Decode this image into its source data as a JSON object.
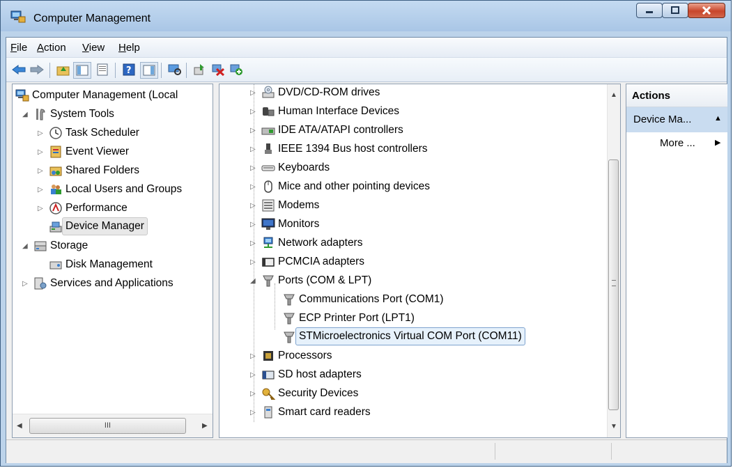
{
  "window": {
    "title": "Computer Management"
  },
  "menu": [
    {
      "key": "F",
      "rest": "ile"
    },
    {
      "key": "A",
      "rest": "ction"
    },
    {
      "key": "V",
      "rest": "iew"
    },
    {
      "key": "H",
      "rest": "elp"
    }
  ],
  "left_tree": [
    {
      "label": "Computer Management (Local",
      "icon": "computer-management-icon",
      "level": 0,
      "expander": "none"
    },
    {
      "label": "System Tools",
      "icon": "tools-icon",
      "level": 1,
      "expander": "expanded"
    },
    {
      "label": "Task Scheduler",
      "icon": "clock-icon",
      "level": 2,
      "expander": "collapsed"
    },
    {
      "label": "Event Viewer",
      "icon": "event-viewer-icon",
      "level": 2,
      "expander": "collapsed"
    },
    {
      "label": "Shared Folders",
      "icon": "shared-folder-icon",
      "level": 2,
      "expander": "collapsed"
    },
    {
      "label": "Local Users and Groups",
      "icon": "users-icon",
      "level": 2,
      "expander": "collapsed"
    },
    {
      "label": "Performance",
      "icon": "performance-icon",
      "level": 2,
      "expander": "collapsed"
    },
    {
      "label": "Device Manager",
      "icon": "device-manager-icon",
      "level": 2,
      "expander": "none",
      "state": "hover"
    },
    {
      "label": "Storage",
      "icon": "storage-icon",
      "level": 1,
      "expander": "expanded"
    },
    {
      "label": "Disk Management",
      "icon": "disk-icon",
      "level": 2,
      "expander": "none"
    },
    {
      "label": "Services and Applications",
      "icon": "services-icon",
      "level": 1,
      "expander": "collapsed"
    }
  ],
  "hscroll": {
    "thumb_label": "III"
  },
  "device_tree": [
    {
      "label": "DVD/CD-ROM drives",
      "icon": "dvd-drive-icon",
      "level": 0,
      "expander": "collapsed"
    },
    {
      "label": "Human Interface Devices",
      "icon": "hid-icon",
      "level": 0,
      "expander": "collapsed"
    },
    {
      "label": "IDE ATA/ATAPI controllers",
      "icon": "ide-controller-icon",
      "level": 0,
      "expander": "collapsed"
    },
    {
      "label": "IEEE 1394 Bus host controllers",
      "icon": "firewire-icon",
      "level": 0,
      "expander": "collapsed"
    },
    {
      "label": "Keyboards",
      "icon": "keyboard-icon",
      "level": 0,
      "expander": "collapsed"
    },
    {
      "label": "Mice and other pointing devices",
      "icon": "mouse-icon",
      "level": 0,
      "expander": "collapsed"
    },
    {
      "label": "Modems",
      "icon": "modem-icon",
      "level": 0,
      "expander": "collapsed"
    },
    {
      "label": "Monitors",
      "icon": "monitor-icon",
      "level": 0,
      "expander": "collapsed"
    },
    {
      "label": "Network adapters",
      "icon": "network-adapter-icon",
      "level": 0,
      "expander": "collapsed"
    },
    {
      "label": "PCMCIA adapters",
      "icon": "pcmcia-icon",
      "level": 0,
      "expander": "collapsed"
    },
    {
      "label": "Ports (COM & LPT)",
      "icon": "port-icon",
      "level": 0,
      "expander": "expanded"
    },
    {
      "label": "Communications Port (COM1)",
      "icon": "port-icon",
      "level": 1,
      "expander": "none"
    },
    {
      "label": "ECP Printer Port (LPT1)",
      "icon": "port-icon",
      "level": 1,
      "expander": "none"
    },
    {
      "label": "STMicroelectronics Virtual COM Port (COM11)",
      "icon": "port-icon",
      "level": 1,
      "expander": "none",
      "state": "selected"
    },
    {
      "label": "Processors",
      "icon": "processor-icon",
      "level": 0,
      "expander": "collapsed"
    },
    {
      "label": "SD host adapters",
      "icon": "sd-adapter-icon",
      "level": 0,
      "expander": "collapsed"
    },
    {
      "label": "Security Devices",
      "icon": "security-device-icon",
      "level": 0,
      "expander": "collapsed"
    },
    {
      "label": "Smart card readers",
      "icon": "smart-card-reader-icon",
      "level": 0,
      "expander": "collapsed"
    }
  ],
  "actions": {
    "header": "Actions",
    "section": "Device Ma...",
    "more": "More ..."
  },
  "colors": {
    "accent_blue": "#1c63b7",
    "selection_bg": "#e6f1fb",
    "selection_border": "#7da2ce"
  }
}
